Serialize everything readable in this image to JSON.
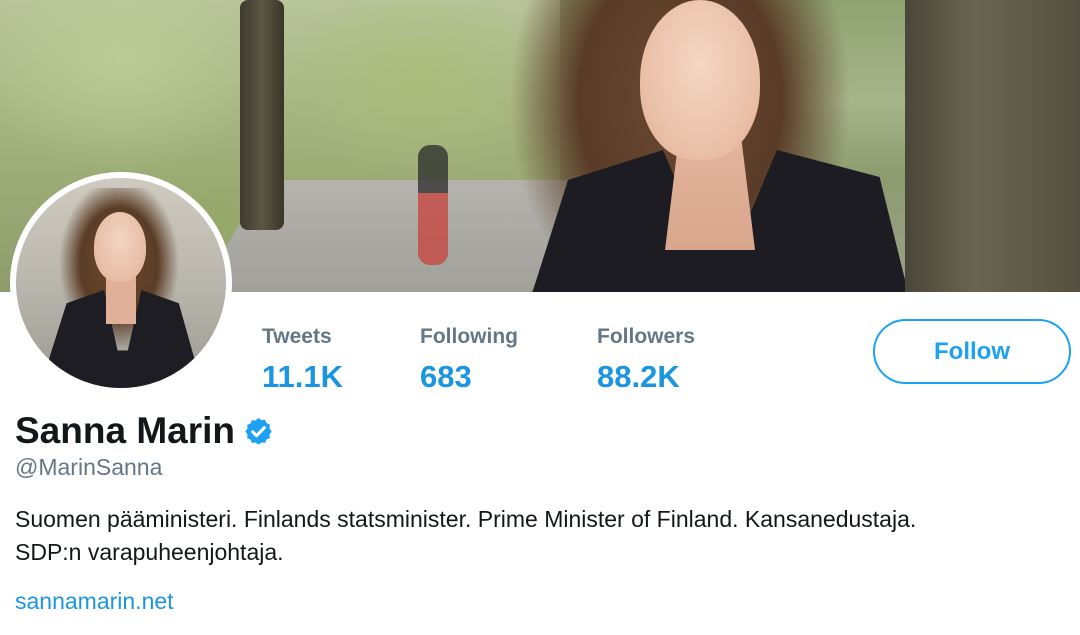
{
  "profile": {
    "name": "Sanna Marin",
    "handle": "@MarinSanna",
    "bio_line1": "Suomen pääministeri. Finlands statsminister. Prime Minister of Finland. Kansanedustaja.",
    "bio_line2": "SDP:n varapuheenjohtaja.",
    "website": "sannamarin.net",
    "verified": true
  },
  "stats": {
    "tweets": {
      "label": "Tweets",
      "value": "11.1K"
    },
    "following": {
      "label": "Following",
      "value": "683"
    },
    "followers": {
      "label": "Followers",
      "value": "88.2K"
    }
  },
  "actions": {
    "follow_label": "Follow"
  },
  "icons": {
    "verified": "verified-badge-icon"
  },
  "colors": {
    "accent": "#1da1f2",
    "link": "#1b95e0",
    "secondary_text": "#657786",
    "primary_text": "#14171a",
    "background": "#ffffff"
  }
}
